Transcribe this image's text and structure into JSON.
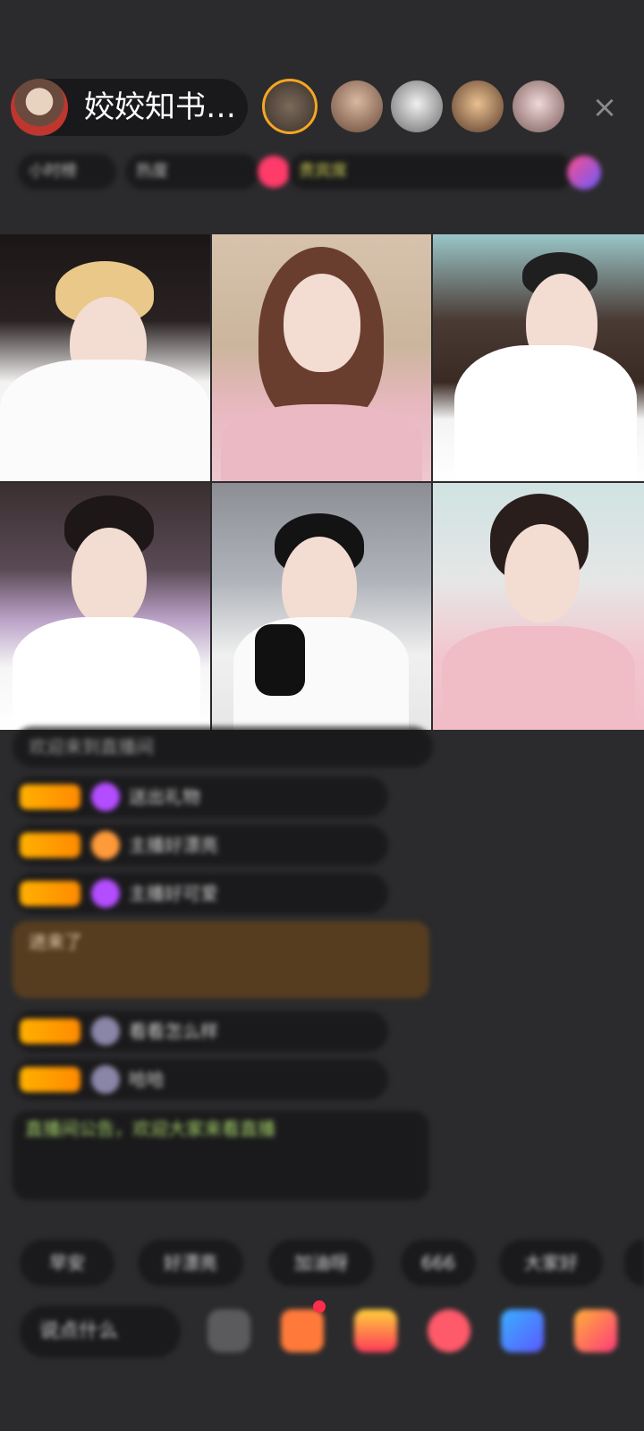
{
  "header": {
    "host_name": "姣姣知书…",
    "close_icon": "×"
  },
  "status_row": {
    "items": [
      "小时榜",
      "热度",
      "贵宾席"
    ]
  },
  "video_grid": {
    "tiles": [
      "guest-1",
      "guest-2",
      "guest-3",
      "guest-4",
      "guest-5",
      "guest-6"
    ]
  },
  "comments": [
    {
      "text": "欢迎来到直播间"
    },
    {
      "text": "送出礼物"
    },
    {
      "text": "主播好漂亮"
    },
    {
      "text": "主播好可爱"
    },
    {
      "text": "进来了"
    },
    {
      "text": "看看怎么样"
    },
    {
      "text": "哈哈"
    },
    {
      "text": "直播间公告，欢迎大家来看直播"
    }
  ],
  "quick_tabs": [
    "早安",
    "好漂亮",
    "加油呀",
    "666",
    "大家好"
  ],
  "bottom_bar": {
    "input_placeholder": "说点什么",
    "tools": [
      "emoji-icon",
      "gift-box-icon",
      "gift-icon",
      "heart-icon",
      "game-icon",
      "more-icon"
    ]
  },
  "colors": {
    "background": "#2b2b2d",
    "badge": "#ffb000",
    "gem": "#b34dff",
    "accent_gold": "#f5a623"
  }
}
